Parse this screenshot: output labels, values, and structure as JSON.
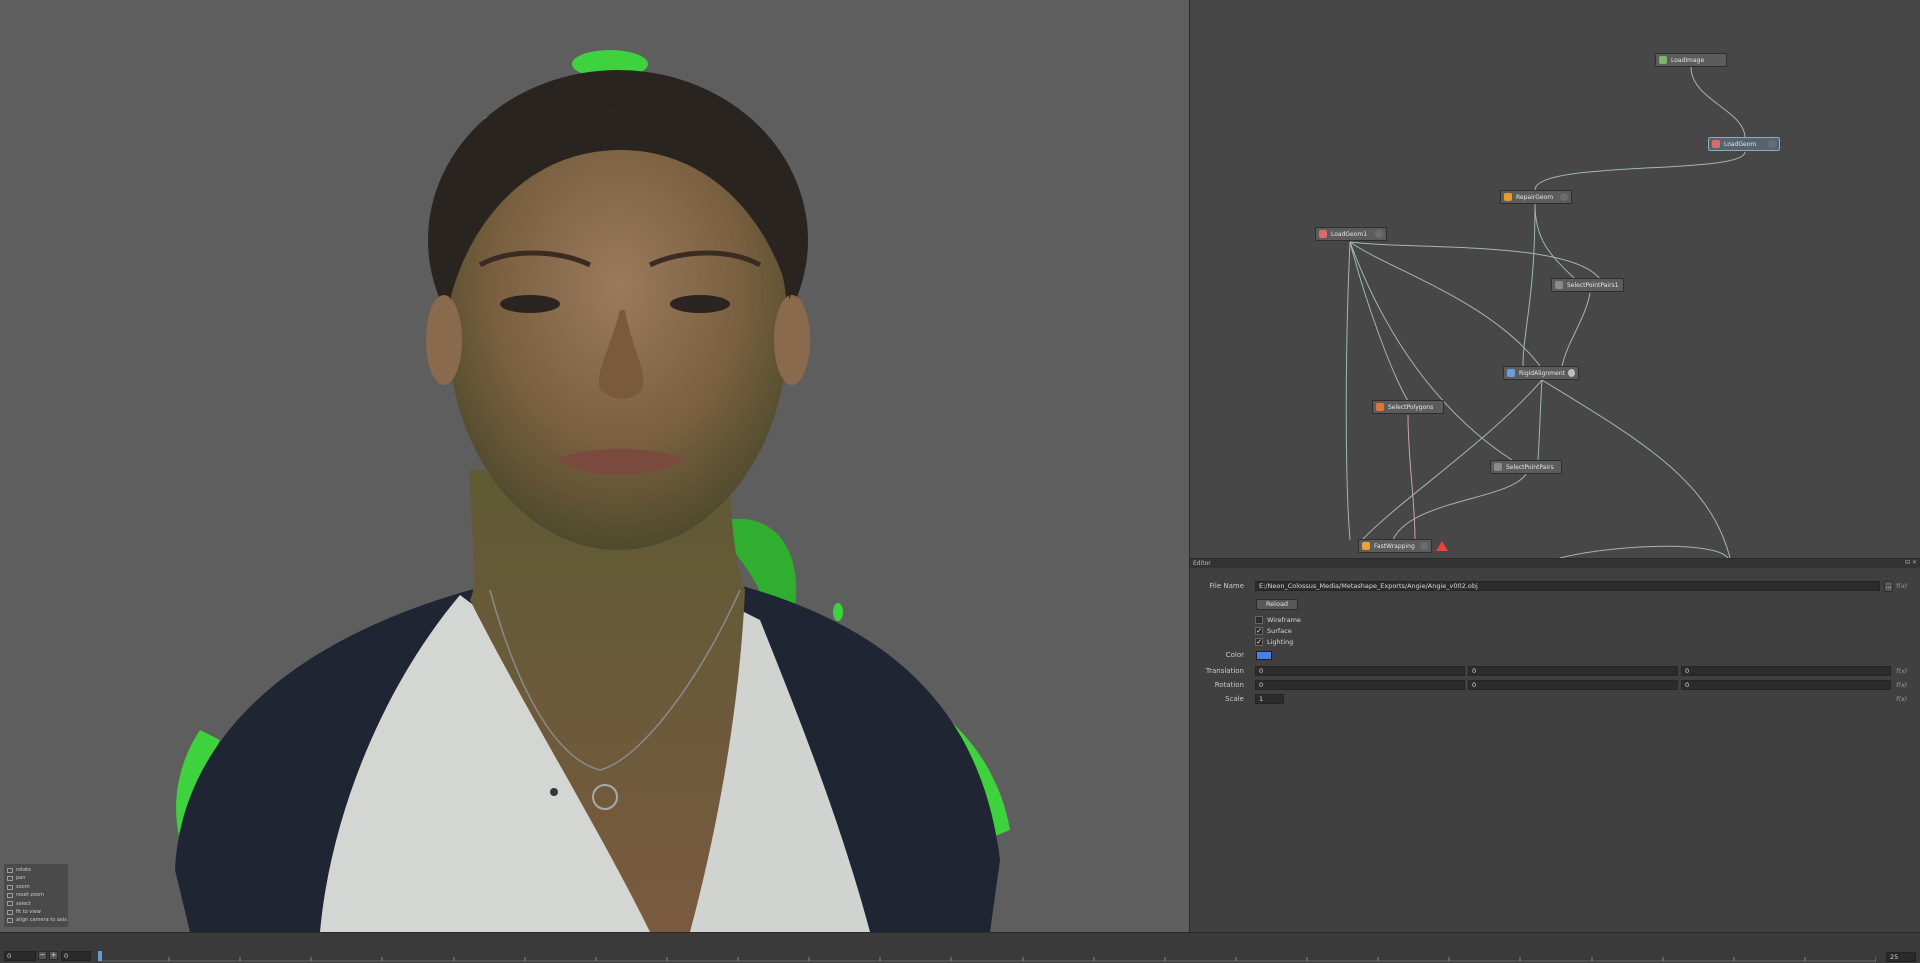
{
  "viewport": {
    "hotkeys": [
      {
        "key": "rotate"
      },
      {
        "key": "pan"
      },
      {
        "key": "zoom"
      },
      {
        "key": "reset zoom"
      },
      {
        "key": "select"
      },
      {
        "key": "fit to view"
      },
      {
        "key": "align camera to axis"
      }
    ]
  },
  "nodegraph": {
    "nodes": [
      {
        "id": "loadimage",
        "label": "LoadImage",
        "icon_color": "#7fb36a"
      },
      {
        "id": "loadgeom",
        "label": "LoadGeom",
        "icon_color": "#d86b6b"
      },
      {
        "id": "repairgeom",
        "label": "RepairGeom",
        "icon_color": "#e89a2e"
      },
      {
        "id": "loadgeom1",
        "label": "LoadGeom1",
        "icon_color": "#d86b6b"
      },
      {
        "id": "selectpointpairs1",
        "label": "SelectPointPairs1",
        "icon_color": "#8a8a8a"
      },
      {
        "id": "rigidalignment",
        "label": "RigidAlignment",
        "icon_color": "#6aa0d8"
      },
      {
        "id": "selectpolygons",
        "label": "SelectPolygons",
        "icon_color": "#e2733a"
      },
      {
        "id": "selectpointpairs",
        "label": "SelectPointPairs",
        "icon_color": "#8a8a8a"
      },
      {
        "id": "wrapping",
        "label": "FastWrapping",
        "icon_color": "#e8a23a"
      }
    ]
  },
  "editor": {
    "title": "Editor",
    "header_buttons": "⊟ ✕",
    "file_name_label": "File Name",
    "file_name_value": "E:/Neon_Colossus_Media/Metashape_Exports/Angie/Angie_v002.obj",
    "browse_label": "…",
    "reload_label": "Reload",
    "wireframe_label": "Wireframe",
    "wireframe_checked": "",
    "surface_label": "Surface",
    "surface_checked": "✓",
    "lighting_label": "Lighting",
    "lighting_checked": "✓",
    "color_label": "Color",
    "color_value": "#4a7fe6",
    "translation_label": "Translation",
    "translation": [
      "0",
      "0",
      "0"
    ],
    "rotation_label": "Rotation",
    "rotation": [
      "0",
      "0",
      "0"
    ],
    "scale_label": "Scale",
    "scale": "1",
    "fx_label": "f(x)"
  },
  "timeline": {
    "start_frame": "0",
    "minus_label": "−",
    "plus_label": "+",
    "current_frame": "0",
    "end_frame": "25",
    "frame_count": 25
  }
}
